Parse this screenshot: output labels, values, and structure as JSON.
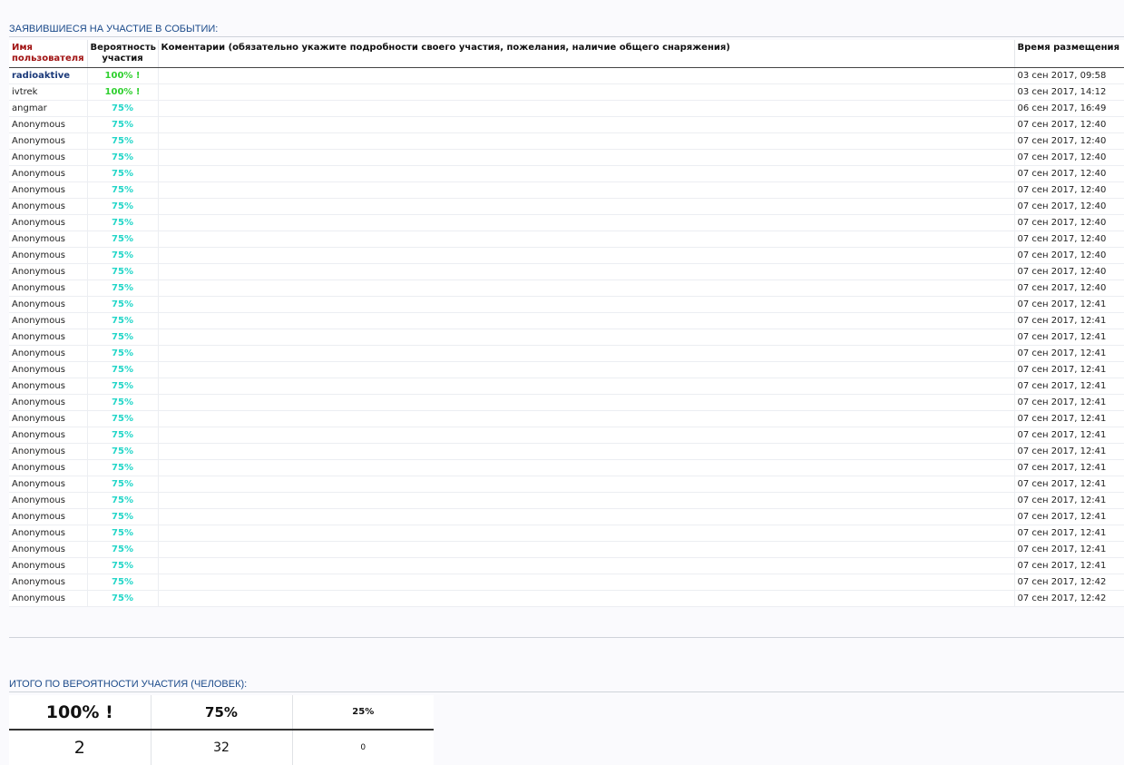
{
  "section_participants_title": "ЗАЯВИВШИЕСЯ НА УЧАСТИЕ В СОБЫТИИ:",
  "table_headers": {
    "user": "Имя пользователя",
    "probability": "Вероятность участия",
    "comments": "Коментарии (обязательно укажите подробности своего участия, пожелания, наличие общего снаряжения)",
    "time": "Время размещения"
  },
  "rows": [
    {
      "user": "radioaktive",
      "prob": "100% !",
      "comment": "",
      "time": "03 сен 2017, 09:58",
      "registered": true
    },
    {
      "user": "ivtrek",
      "prob": "100% !",
      "comment": "",
      "time": "03 сен 2017, 14:12",
      "registered": false
    },
    {
      "user": "angmar",
      "prob": "75%",
      "comment": "",
      "time": "06 сен 2017, 16:49",
      "registered": false
    },
    {
      "user": "Anonymous",
      "prob": "75%",
      "comment": "",
      "time": "07 сен 2017, 12:40",
      "registered": false
    },
    {
      "user": "Anonymous",
      "prob": "75%",
      "comment": "",
      "time": "07 сен 2017, 12:40",
      "registered": false
    },
    {
      "user": "Anonymous",
      "prob": "75%",
      "comment": "",
      "time": "07 сен 2017, 12:40",
      "registered": false
    },
    {
      "user": "Anonymous",
      "prob": "75%",
      "comment": "",
      "time": "07 сен 2017, 12:40",
      "registered": false
    },
    {
      "user": "Anonymous",
      "prob": "75%",
      "comment": "",
      "time": "07 сен 2017, 12:40",
      "registered": false
    },
    {
      "user": "Anonymous",
      "prob": "75%",
      "comment": "",
      "time": "07 сен 2017, 12:40",
      "registered": false
    },
    {
      "user": "Anonymous",
      "prob": "75%",
      "comment": "",
      "time": "07 сен 2017, 12:40",
      "registered": false
    },
    {
      "user": "Anonymous",
      "prob": "75%",
      "comment": "",
      "time": "07 сен 2017, 12:40",
      "registered": false
    },
    {
      "user": "Anonymous",
      "prob": "75%",
      "comment": "",
      "time": "07 сен 2017, 12:40",
      "registered": false
    },
    {
      "user": "Anonymous",
      "prob": "75%",
      "comment": "",
      "time": "07 сен 2017, 12:40",
      "registered": false
    },
    {
      "user": "Anonymous",
      "prob": "75%",
      "comment": "",
      "time": "07 сен 2017, 12:40",
      "registered": false
    },
    {
      "user": "Anonymous",
      "prob": "75%",
      "comment": "",
      "time": "07 сен 2017, 12:41",
      "registered": false
    },
    {
      "user": "Anonymous",
      "prob": "75%",
      "comment": "",
      "time": "07 сен 2017, 12:41",
      "registered": false
    },
    {
      "user": "Anonymous",
      "prob": "75%",
      "comment": "",
      "time": "07 сен 2017, 12:41",
      "registered": false
    },
    {
      "user": "Anonymous",
      "prob": "75%",
      "comment": "",
      "time": "07 сен 2017, 12:41",
      "registered": false
    },
    {
      "user": "Anonymous",
      "prob": "75%",
      "comment": "",
      "time": "07 сен 2017, 12:41",
      "registered": false
    },
    {
      "user": "Anonymous",
      "prob": "75%",
      "comment": "",
      "time": "07 сен 2017, 12:41",
      "registered": false
    },
    {
      "user": "Anonymous",
      "prob": "75%",
      "comment": "",
      "time": "07 сен 2017, 12:41",
      "registered": false
    },
    {
      "user": "Anonymous",
      "prob": "75%",
      "comment": "",
      "time": "07 сен 2017, 12:41",
      "registered": false
    },
    {
      "user": "Anonymous",
      "prob": "75%",
      "comment": "",
      "time": "07 сен 2017, 12:41",
      "registered": false
    },
    {
      "user": "Anonymous",
      "prob": "75%",
      "comment": "",
      "time": "07 сен 2017, 12:41",
      "registered": false
    },
    {
      "user": "Anonymous",
      "prob": "75%",
      "comment": "",
      "time": "07 сен 2017, 12:41",
      "registered": false
    },
    {
      "user": "Anonymous",
      "prob": "75%",
      "comment": "",
      "time": "07 сен 2017, 12:41",
      "registered": false
    },
    {
      "user": "Anonymous",
      "prob": "75%",
      "comment": "",
      "time": "07 сен 2017, 12:41",
      "registered": false
    },
    {
      "user": "Anonymous",
      "prob": "75%",
      "comment": "",
      "time": "07 сен 2017, 12:41",
      "registered": false
    },
    {
      "user": "Anonymous",
      "prob": "75%",
      "comment": "",
      "time": "07 сен 2017, 12:41",
      "registered": false
    },
    {
      "user": "Anonymous",
      "prob": "75%",
      "comment": "",
      "time": "07 сен 2017, 12:41",
      "registered": false
    },
    {
      "user": "Anonymous",
      "prob": "75%",
      "comment": "",
      "time": "07 сен 2017, 12:41",
      "registered": false
    },
    {
      "user": "Anonymous",
      "prob": "75%",
      "comment": "",
      "time": "07 сен 2017, 12:42",
      "registered": false
    },
    {
      "user": "Anonymous",
      "prob": "75%",
      "comment": "",
      "time": "07 сен 2017, 12:42",
      "registered": false
    }
  ],
  "section_totals_title": "ИТОГО ПО ВЕРОЯТНОСТИ УЧАСТИЯ (ЧЕЛОВЕК):",
  "totals": {
    "headers": [
      "100% !",
      "75%",
      "25%"
    ],
    "values": [
      "2",
      "32",
      "0"
    ]
  },
  "colors": {
    "title": "#1b4a8a",
    "user_header": "#a01212",
    "prob_100": "#2fd02f",
    "prob_75": "#22d6c8",
    "registered_user": "#1b3a7a"
  }
}
